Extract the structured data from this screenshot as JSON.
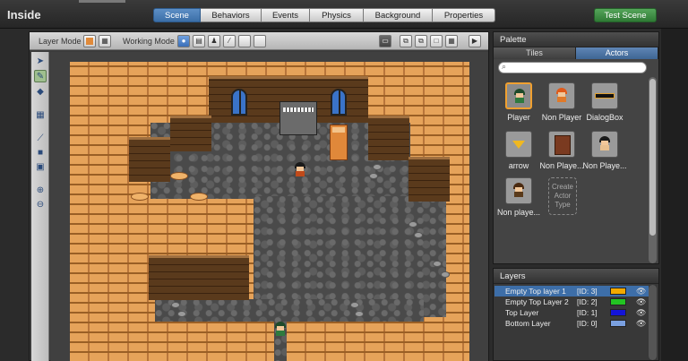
{
  "app": {
    "title": "Inside"
  },
  "tabs": [
    {
      "label": "Scene",
      "active": true
    },
    {
      "label": "Behaviors",
      "active": false
    },
    {
      "label": "Events",
      "active": false
    },
    {
      "label": "Physics",
      "active": false
    },
    {
      "label": "Background",
      "active": false
    },
    {
      "label": "Properties",
      "active": false
    }
  ],
  "test_scene_label": "Test Scene",
  "scene_toolbar": {
    "layer_mode_label": "Layer Mode",
    "working_mode_label": "Working Mode"
  },
  "tools": [
    "arrow-tool",
    "pencil-tool",
    "fill-tool",
    "grid-tool",
    "line-tool",
    "rect-tool",
    "marquee-tool",
    "zoom-in-tool",
    "zoom-out-tool"
  ],
  "palette": {
    "title": "Palette",
    "tabs": [
      {
        "label": "Tiles",
        "active": false
      },
      {
        "label": "Actors",
        "active": true
      }
    ],
    "search_placeholder": "",
    "actors": [
      {
        "name": "Player",
        "selected": true
      },
      {
        "name": "Non Player",
        "selected": false
      },
      {
        "name": "DialogBox",
        "selected": false
      },
      {
        "name": "arrow",
        "selected": false
      },
      {
        "name": "Non Playe...",
        "selected": false
      },
      {
        "name": "Non Playe...",
        "selected": false
      },
      {
        "name": "Non playe...",
        "selected": false
      }
    ],
    "create_label": "Create Actor Type"
  },
  "layers": {
    "title": "Layers",
    "rows": [
      {
        "name": "Empty Top layer 1",
        "id": "[ID: 3]",
        "color": "#f2a900",
        "selected": true
      },
      {
        "name": "Empty Top Layer 2",
        "id": "[ID: 2]",
        "color": "#22c422",
        "selected": false
      },
      {
        "name": "Top Layer",
        "id": "[ID: 1]",
        "color": "#1414d8",
        "selected": false
      },
      {
        "name": "Bottom Layer",
        "id": "[ID: 0]",
        "color": "#7aa0e0",
        "selected": false
      }
    ]
  }
}
